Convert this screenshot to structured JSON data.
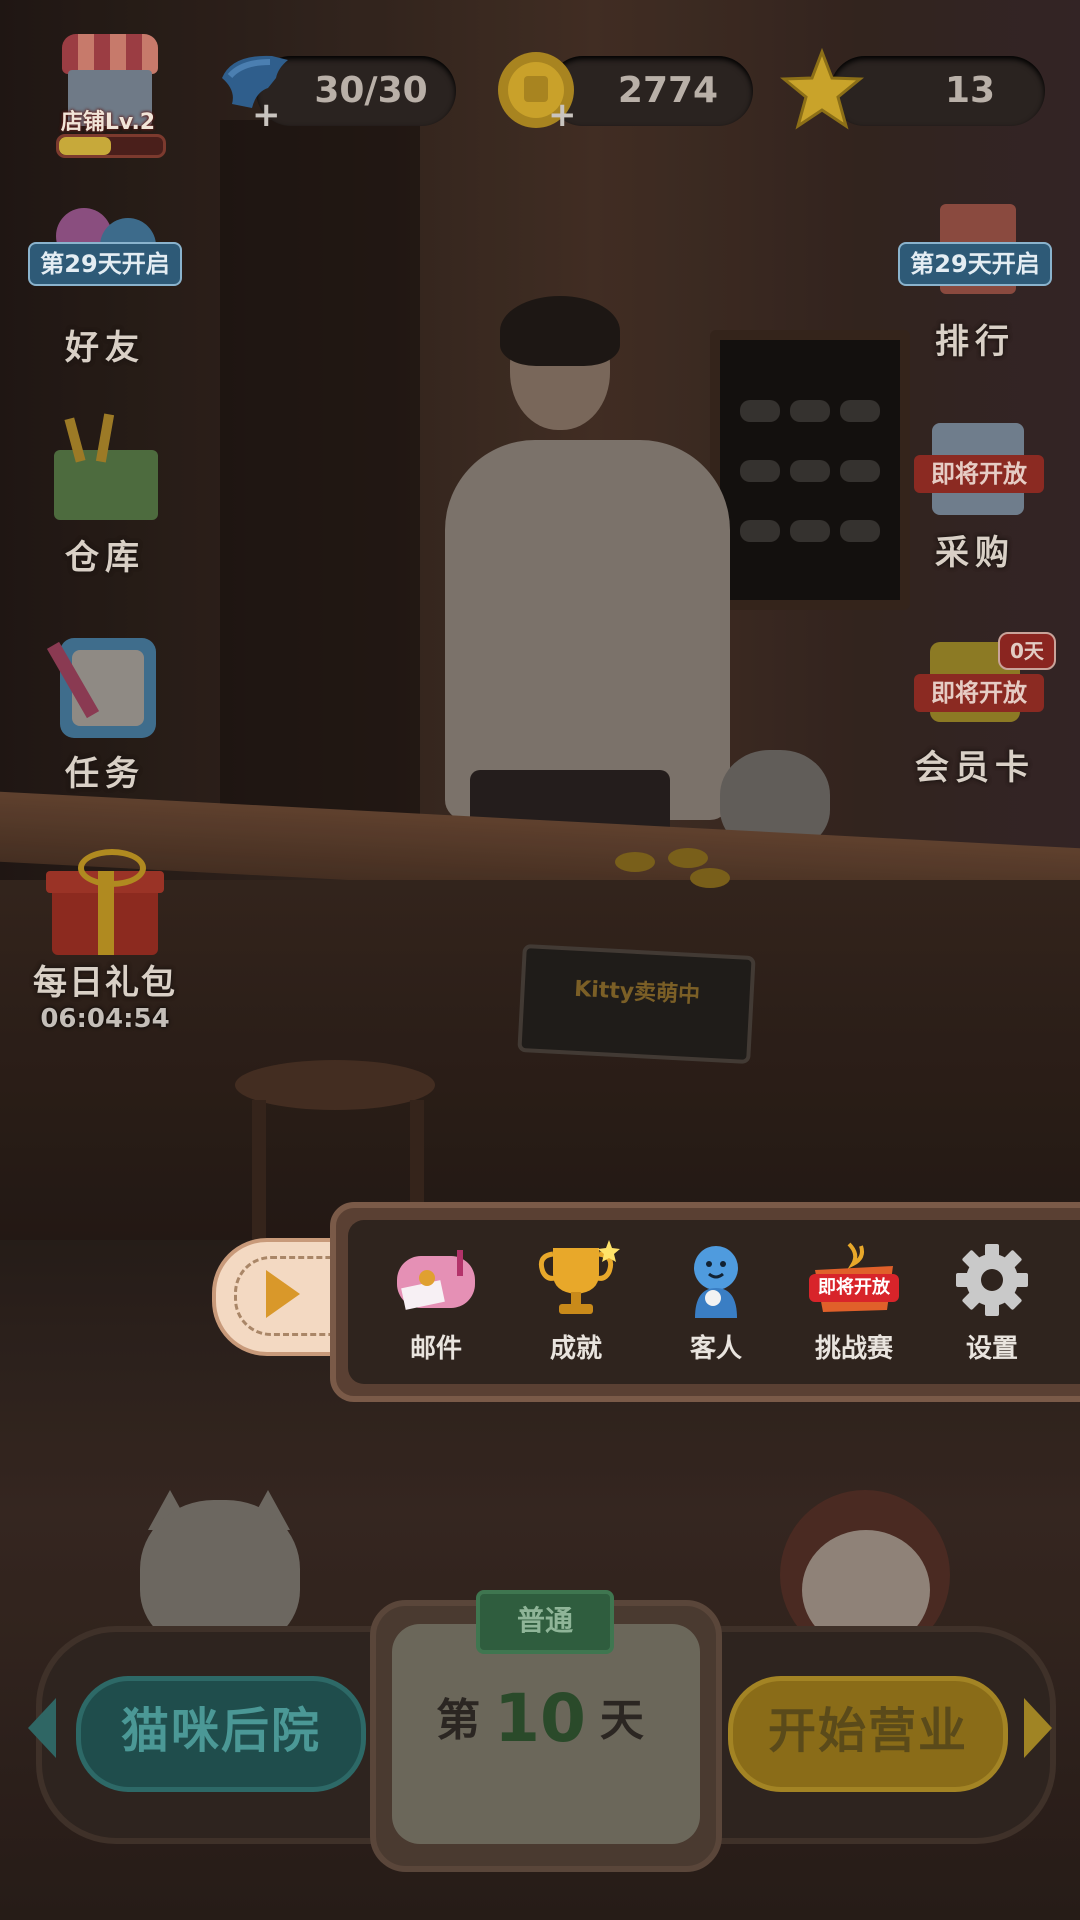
{
  "top_bar": {
    "shop_label": "店铺Lv.2",
    "shop_progress": 0.5,
    "energy": "30/30",
    "coins": "2774",
    "stars": "13"
  },
  "left_menu": {
    "friends": {
      "label": "好友",
      "ribbon": "第29天开启"
    },
    "warehouse": {
      "label": "仓库"
    },
    "tasks": {
      "label": "任务"
    },
    "daily_gift": {
      "label": "每日礼包",
      "timer": "06:04:54"
    }
  },
  "right_menu": {
    "ranking": {
      "label": "排行",
      "ribbon": "第29天开启"
    },
    "purchase": {
      "label": "采购",
      "ribbon": "即将开放"
    },
    "vip_card": {
      "label": "会员卡",
      "ribbon": "即将开放",
      "badge": "0天"
    }
  },
  "scene": {
    "sign_text": "Kitty卖萌中"
  },
  "popup_menu": {
    "items": [
      {
        "label": "邮件"
      },
      {
        "label": "成就"
      },
      {
        "label": "客人"
      },
      {
        "label": "挑战赛",
        "ribbon": "即将开放"
      },
      {
        "label": "设置"
      }
    ]
  },
  "bottom_bar": {
    "backyard_label": "猫咪后院",
    "difficulty": "普通",
    "day_prefix": "第",
    "day_number": "10",
    "day_suffix": "天",
    "open_label": "开始营业"
  },
  "colors": {
    "coin": "#c9a12a",
    "energy": "#2f5e8c",
    "star": "#c9a32a",
    "backyard_button": "#1f4d4c",
    "open_button": "#8a6c18"
  }
}
